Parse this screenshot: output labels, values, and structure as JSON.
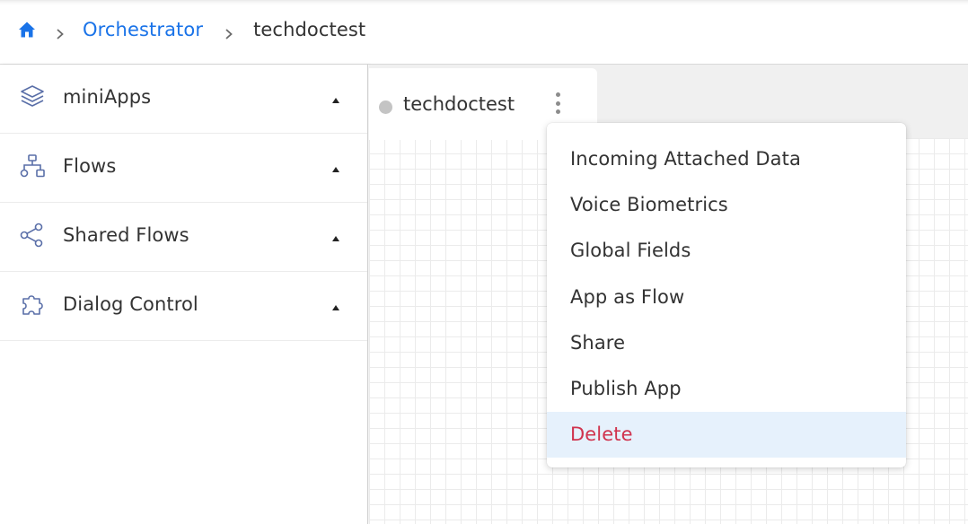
{
  "breadcrumb": {
    "home_icon": "home-icon",
    "items": [
      {
        "label": "Orchestrator",
        "link": true
      },
      {
        "label": "techdoctest",
        "link": false
      }
    ]
  },
  "sidebar": {
    "items": [
      {
        "label": "miniApps",
        "icon": "layers-icon"
      },
      {
        "label": "Flows",
        "icon": "flow-tree-icon"
      },
      {
        "label": "Shared Flows",
        "icon": "share-icon"
      },
      {
        "label": "Dialog Control",
        "icon": "puzzle-icon"
      }
    ]
  },
  "canvas": {
    "tab_label": "techdoctest"
  },
  "menu": {
    "items": [
      "Incoming Attached Data",
      "Voice Biometrics",
      "Global Fields",
      "App as Flow",
      "Share",
      "Publish App",
      "Delete"
    ]
  },
  "colors": {
    "accent": "#1a73e8",
    "icon": "#5a6fa8",
    "danger": "#d0334e",
    "highlight": "#e6f1fc"
  }
}
